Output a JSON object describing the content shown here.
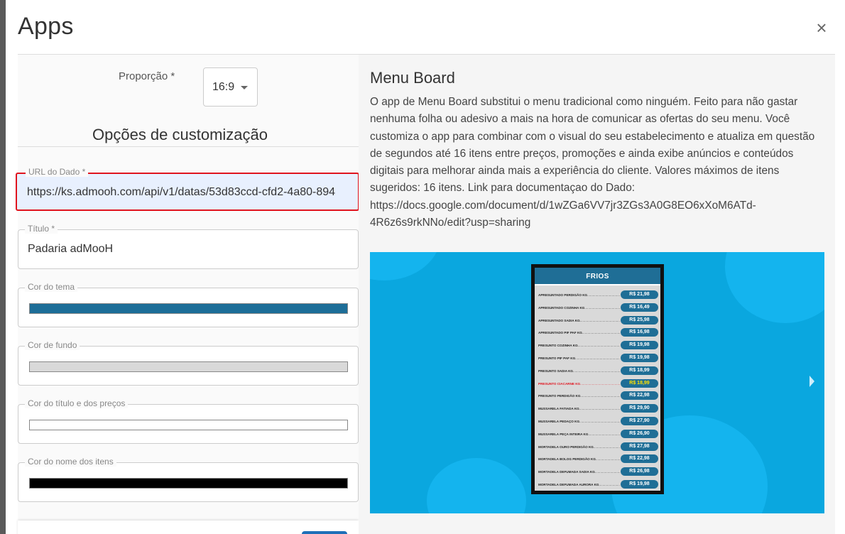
{
  "dialog": {
    "title": "Apps",
    "close_label": "×"
  },
  "form": {
    "proportion_label": "Proporção *",
    "proportion_value": "16:9",
    "customization_heading": "Opções de customização",
    "url_label": "URL do Dado *",
    "url_value": "https://ks.admooh.com/api/v1/datas/53d83ccd-cfd2-4a80-894",
    "title_label": "Título *",
    "title_value": "Padaria adMooH",
    "theme_color_label": "Cor do tema",
    "theme_color": "#1d6e98",
    "bg_color_label": "Cor de fundo",
    "bg_color": "#d9d9d9",
    "title_price_color_label": "Cor do título e dos preços",
    "title_price_color": "#ffffff",
    "item_name_color_label": "Cor do nome dos itens",
    "item_name_color": "#000000"
  },
  "info": {
    "title": "Menu Board",
    "description": "O app de Menu Board substitui o menu tradicional como ninguém. Feito para não gastar nenhuma folha ou adesivo a mais na hora de comunicar as ofertas do seu menu. Você customiza o app para combinar com o visual do seu estabelecimento e atualiza em questão de segundos até 16 itens entre preços, promoções e ainda exibe anúncios e conteúdos digitais para melhorar ainda mais a experiência do cliente. Valores máximos de itens sugeridos: 16 itens. Link para documentaçao do Dado: https://docs.google.com/document/d/1wZGa6VV7jr3ZGs3A0G8EO6xXoM6ATd-4R6z6s9rkNNo/edit?usp=sharing"
  },
  "preview": {
    "board_title": "FRIOS",
    "items": [
      {
        "name": "APRESUNTADO PERDIGÃO KG",
        "price": "R$ 21,98"
      },
      {
        "name": "APRESUNTADO COZINHA KG",
        "price": "R$ 16,49"
      },
      {
        "name": "APRESUNTADO SADIA KG",
        "price": "R$ 25,98"
      },
      {
        "name": "APRESUNTADO PIF PAF KG",
        "price": "R$ 16,98"
      },
      {
        "name": "PRESUNTO COZINHA KG",
        "price": "R$ 19,98"
      },
      {
        "name": "PRESUNTO PIF PAF KG",
        "price": "R$ 19,98"
      },
      {
        "name": "PRESUNTO SADIA KG",
        "price": "R$ 18,99"
      },
      {
        "name": "PRESUNTO CIACARNE KG",
        "price": "R$ 18,99",
        "highlight": true
      },
      {
        "name": "PRESUNTO PERDIGÃO KG",
        "price": "R$ 22,98"
      },
      {
        "name": "MUSSARELA FATIADA KG",
        "price": "R$ 29,90"
      },
      {
        "name": "MUSSARELA PEDAÇO KG",
        "price": "R$ 27,90"
      },
      {
        "name": "MUSSARELA PEÇA INTEIRA KG",
        "price": "R$ 26,90"
      },
      {
        "name": "MORTADELA OURO PERDIGÃO KG",
        "price": "R$ 27,98"
      },
      {
        "name": "MORTADELA BOLOG PERDIGÃO KG",
        "price": "R$ 22,98"
      },
      {
        "name": "MORTADELA DEFUMADA SADIA KG",
        "price": "R$ 26,98"
      },
      {
        "name": "MORTADELA DEFUMADA AURORA KG",
        "price": "R$ 19,98"
      }
    ]
  }
}
